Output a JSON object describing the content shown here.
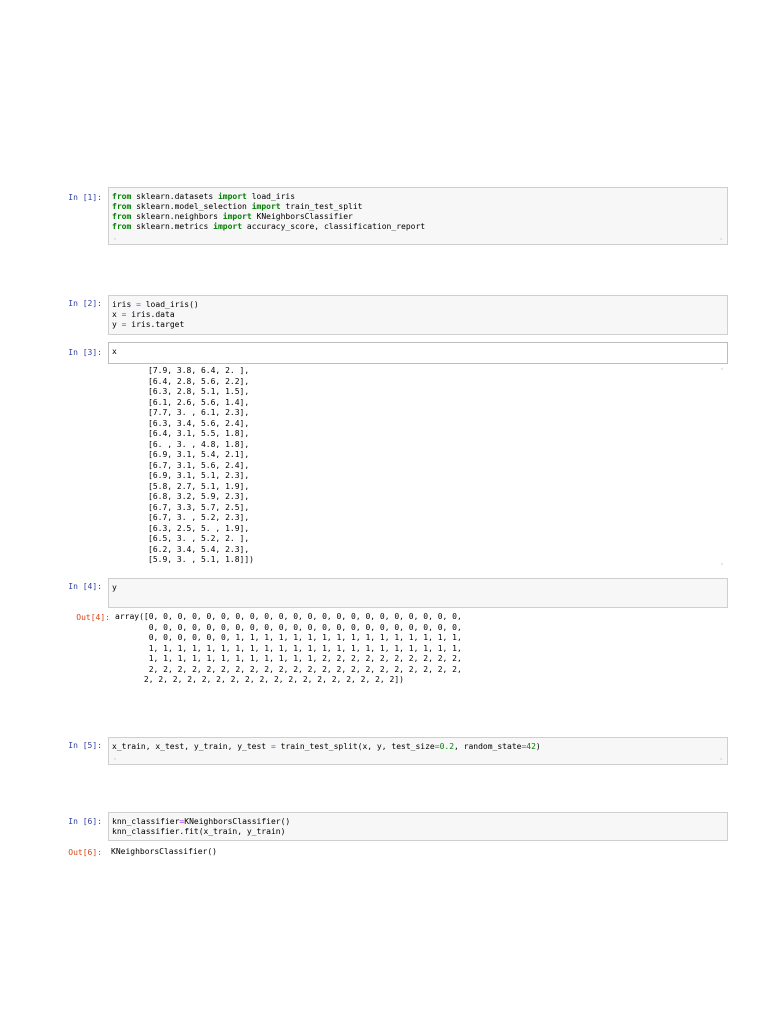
{
  "cells": [
    {
      "prompt": "In [1]:",
      "lines": [
        [
          [
            "from",
            "kw"
          ],
          [
            " sklearn.datasets ",
            ""
          ],
          [
            "import",
            "kw"
          ],
          [
            " load_iris",
            ""
          ]
        ],
        [
          [
            "from",
            "kw"
          ],
          [
            " sklearn.model_selection ",
            ""
          ],
          [
            "import",
            "kw"
          ],
          [
            " train_test_split",
            ""
          ]
        ],
        [
          [
            "from",
            "kw"
          ],
          [
            " sklearn.neighbors ",
            ""
          ],
          [
            "import",
            "kw"
          ],
          [
            " KNeighborsClassifier",
            ""
          ]
        ],
        [
          [
            "from",
            "kw"
          ],
          [
            " sklearn.metrics ",
            ""
          ],
          [
            "import",
            "kw"
          ],
          [
            " accuracy_score, classification_report",
            ""
          ]
        ]
      ]
    },
    {
      "prompt": "In [2]:",
      "lines": [
        [
          [
            "iris ",
            ""
          ],
          [
            "=",
            "op"
          ],
          [
            " load_iris()",
            ""
          ]
        ],
        [
          [
            "x ",
            ""
          ],
          [
            "=",
            "op"
          ],
          [
            " iris.data",
            ""
          ]
        ],
        [
          [
            "y ",
            ""
          ],
          [
            "=",
            "op"
          ],
          [
            " iris.target",
            ""
          ]
        ]
      ]
    },
    {
      "prompt": "In [3]:",
      "lines": [
        [
          [
            "x",
            ""
          ]
        ]
      ]
    },
    {
      "prompt": "In [4]:",
      "lines": [
        [
          [
            "y",
            ""
          ]
        ]
      ]
    },
    {
      "prompt": "In [5]:",
      "lines": [
        [
          [
            "x_train, x_test, y_train, y_test ",
            ""
          ],
          [
            "=",
            "op"
          ],
          [
            " train_test_split(x, y, test_size",
            ""
          ],
          [
            "=",
            "op"
          ],
          [
            "0.2",
            "num"
          ],
          [
            ", random_state",
            ""
          ],
          [
            "=",
            "op"
          ],
          [
            "42",
            "num"
          ],
          [
            ")",
            ""
          ]
        ]
      ]
    },
    {
      "prompt": "In [6]:",
      "lines": [
        [
          [
            "knn_classifier",
            ""
          ],
          [
            "=",
            "op"
          ],
          [
            "KNeighborsClassifier()",
            ""
          ]
        ],
        [
          [
            "knn_classifier.fit(x_train, y_train)",
            ""
          ]
        ]
      ]
    }
  ],
  "out3": [
    "[7.9, 3.8, 6.4, 2. ],",
    "[6.4, 2.8, 5.6, 2.2],",
    "[6.3, 2.8, 5.1, 1.5],",
    "[6.1, 2.6, 5.6, 1.4],",
    "[7.7, 3. , 6.1, 2.3],",
    "[6.3, 3.4, 5.6, 2.4],",
    "[6.4, 3.1, 5.5, 1.8],",
    "[6. , 3. , 4.8, 1.8],",
    "[6.9, 3.1, 5.4, 2.1],",
    "[6.7, 3.1, 5.6, 2.4],",
    "[6.9, 3.1, 5.1, 2.3],",
    "[5.8, 2.7, 5.1, 1.9],",
    "[6.8, 3.2, 5.9, 2.3],",
    "[6.7, 3.3, 5.7, 2.5],",
    "[6.7, 3. , 5.2, 2.3],",
    "[6.3, 2.5, 5. , 1.9],",
    "[6.5, 3. , 5.2, 2. ],",
    "[6.2, 3.4, 5.4, 2.3],",
    "[5.9, 3. , 5.1, 1.8]])"
  ],
  "out4": {
    "prompt": "Out[4]:",
    "lines": [
      "array([0, 0, 0, 0, 0, 0, 0, 0, 0, 0, 0, 0, 0, 0, 0, 0, 0, 0, 0, 0, 0, 0,",
      "       0, 0, 0, 0, 0, 0, 0, 0, 0, 0, 0, 0, 0, 0, 0, 0, 0, 0, 0, 0, 0, 0,",
      "       0, 0, 0, 0, 0, 0, 1, 1, 1, 1, 1, 1, 1, 1, 1, 1, 1, 1, 1, 1, 1, 1,",
      "       1, 1, 1, 1, 1, 1, 1, 1, 1, 1, 1, 1, 1, 1, 1, 1, 1, 1, 1, 1, 1, 1,",
      "       1, 1, 1, 1, 1, 1, 1, 1, 1, 1, 1, 1, 2, 2, 2, 2, 2, 2, 2, 2, 2, 2,",
      "       2, 2, 2, 2, 2, 2, 2, 2, 2, 2, 2, 2, 2, 2, 2, 2, 2, 2, 2, 2, 2, 2,",
      "      2, 2, 2, 2, 2, 2, 2, 2, 2, 2, 2, 2, 2, 2, 2, 2, 2, 2])"
    ]
  },
  "out6": {
    "prompt": "Out[6]:",
    "text": "KNeighborsClassifier()"
  },
  "scroll_glyph": "◦"
}
